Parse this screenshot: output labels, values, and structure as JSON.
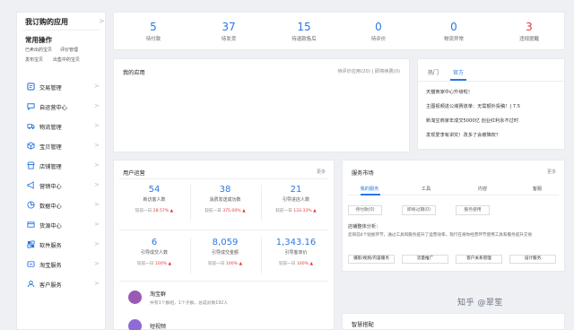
{
  "sidebar": {
    "title": "我订购的应用",
    "common_ops": "常用操作",
    "quick_links": [
      "已卖出的宝贝",
      "评价管理",
      "发布宝贝",
      "出售中的宝贝"
    ],
    "menu": [
      {
        "label": "交易管理",
        "icon": "trade-icon"
      },
      {
        "label": "自运营中心",
        "icon": "chat-icon"
      },
      {
        "label": "物流管理",
        "icon": "truck-icon"
      },
      {
        "label": "宝贝管理",
        "icon": "box-icon"
      },
      {
        "label": "店铺管理",
        "icon": "store-icon"
      },
      {
        "label": "营销中心",
        "icon": "megaphone-icon"
      },
      {
        "label": "数据中心",
        "icon": "data-icon"
      },
      {
        "label": "货源中心",
        "icon": "source-icon"
      },
      {
        "label": "软件服务",
        "icon": "software-icon"
      },
      {
        "label": "淘宝服务",
        "icon": "taobao-icon"
      },
      {
        "label": "客户服务",
        "icon": "user-icon"
      }
    ],
    "chevron": ">"
  },
  "stats": [
    {
      "value": "5",
      "label": "待付款"
    },
    {
      "value": "37",
      "label": "待发货"
    },
    {
      "value": "15",
      "label": "待退款售后"
    },
    {
      "value": "0",
      "label": "待评价"
    },
    {
      "value": "0",
      "label": "物流异常"
    },
    {
      "value": "3",
      "label": "违规提醒",
      "red": true
    }
  ],
  "apps": {
    "title": "我的应用",
    "right": "待评价应用(20) | 即将续费(0)"
  },
  "news": {
    "tabs": [
      "热门",
      "官方"
    ],
    "items": [
      "天猫商家中心升级啦！",
      "主图视频进公域赛道单：无需额外投稿！| 7.5",
      "新淘宝商家年成交5000亿 创业红利永不过时",
      "发现爱李有讲究！改多了会被降权？"
    ]
  },
  "ops": {
    "title": "用户运营",
    "more": "更多",
    "cells": [
      {
        "value": "54",
        "label": "新访客人数",
        "prev": "较前一日",
        "pct": "28.57%"
      },
      {
        "value": "38",
        "label": "消费发送成功数",
        "prev": "较前一日",
        "pct": "375.00%"
      },
      {
        "value": "21",
        "label": "引导进店人数",
        "prev": "较前一日",
        "pct": "133.33%"
      },
      {
        "value": "6",
        "label": "引导成交人数",
        "prev": "较前一日",
        "pct": "100%"
      },
      {
        "value": "8,059",
        "label": "引导成交金额",
        "prev": "较前一日",
        "pct": "100%"
      },
      {
        "value": "1,343.16",
        "label": "引导客单价",
        "prev": "较前一日",
        "pct": "100%"
      }
    ],
    "group_title": "淘宝群",
    "group_desc": "共有1个群组，1个子群，总成员数192人",
    "video_title": "短视频"
  },
  "market": {
    "title": "服务市场",
    "more": "更多",
    "tabs": [
      "我的服务",
      "工具",
      "内容",
      "客服"
    ],
    "pills": [
      "待付款(0)",
      "即将过期(0)",
      "服务使用"
    ],
    "analysis_title": "店铺整体分析：",
    "analysis_text": "您目前4个短板环节，通过工具和服务提升了运营效率，现行在将你经营环节使用工具和服务提升交易",
    "tags": [
      "摄影/视频/内容服务",
      "流量推广",
      "客户关系管理",
      "设计服务"
    ]
  },
  "smart": {
    "title": "智慧搭配"
  },
  "watermark": "知乎 @翠笙"
}
